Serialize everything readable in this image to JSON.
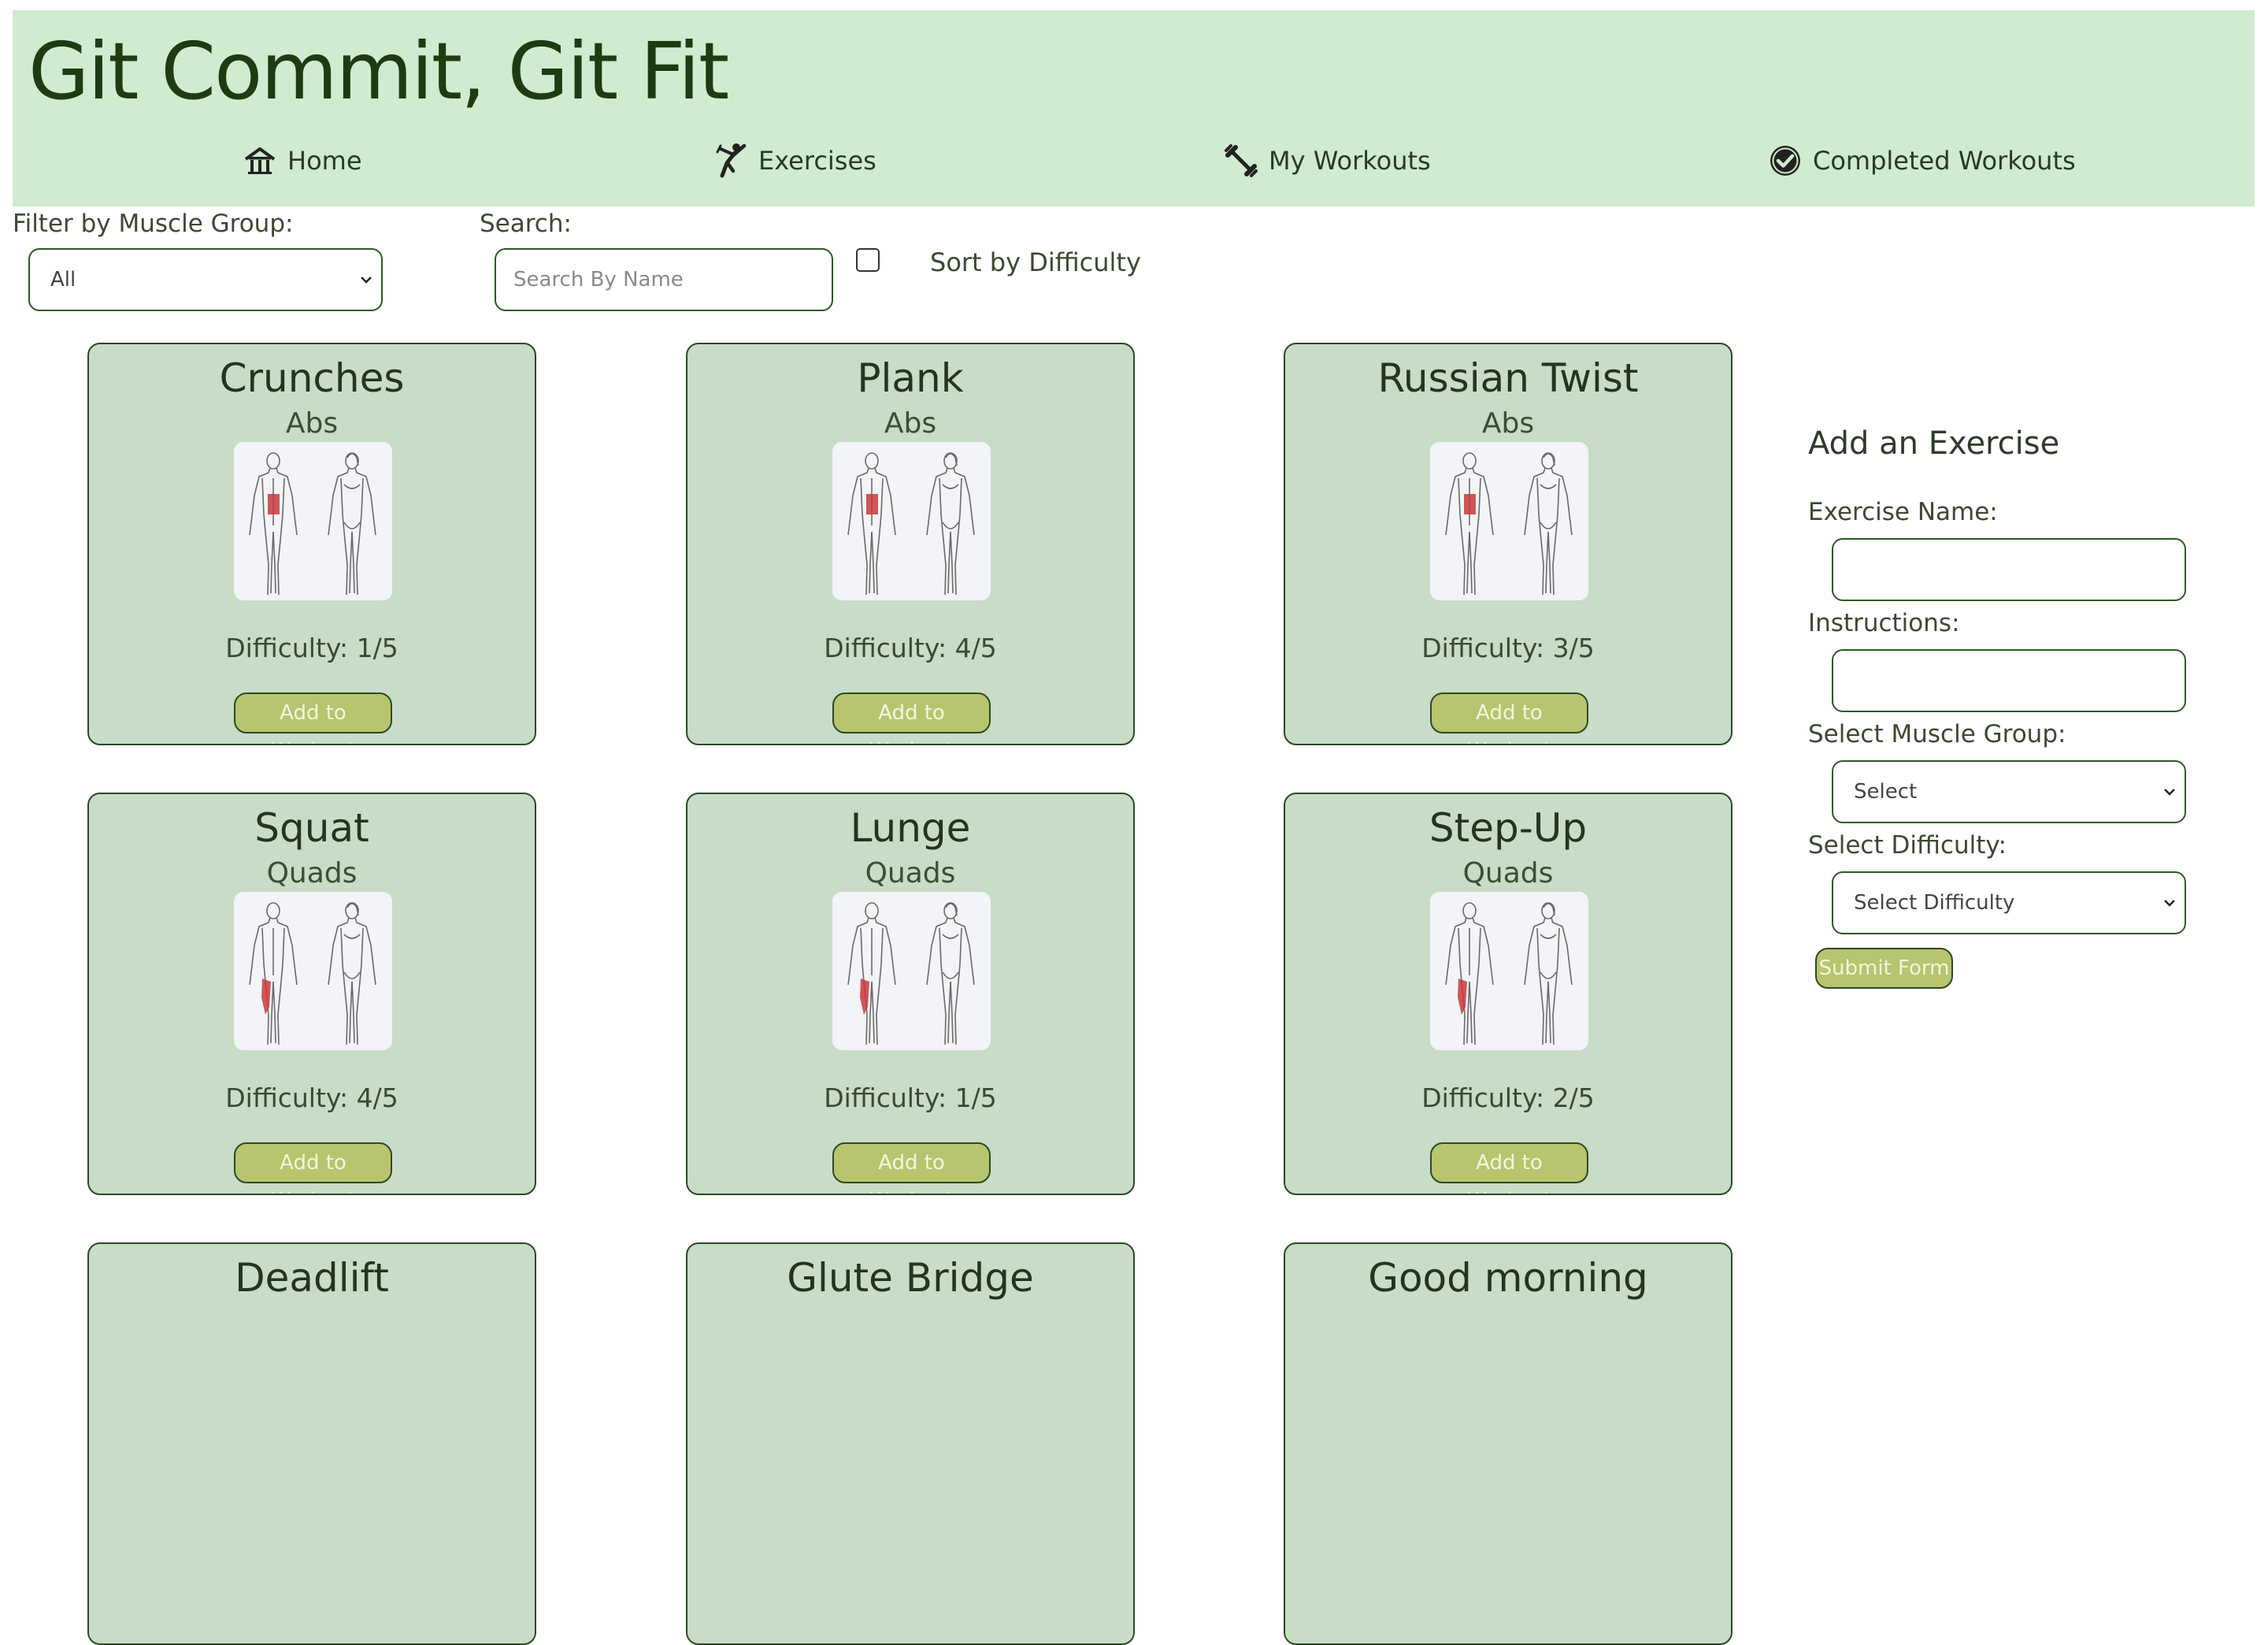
{
  "header": {
    "title": "Git Commit, Git Fit",
    "nav": [
      {
        "label": "Home",
        "icon": "house-icon"
      },
      {
        "label": "Exercises",
        "icon": "martial-arts-icon"
      },
      {
        "label": "My Workouts",
        "icon": "dumbbell-icon"
      },
      {
        "label": "Completed Workouts",
        "icon": "check-circle-icon"
      }
    ]
  },
  "filters": {
    "muscle_label": "Filter by Muscle Group:",
    "muscle_value": "All",
    "search_label": "Search:",
    "search_placeholder": "Search By Name",
    "sort_label": "Sort by Difficulty",
    "sort_checked": false
  },
  "exercises": [
    {
      "name": "Crunches",
      "muscle": "Abs",
      "difficulty": "Difficulty: 1/5",
      "button": "Add to Workout",
      "highlight": "abs"
    },
    {
      "name": "Plank",
      "muscle": "Abs",
      "difficulty": "Difficulty: 4/5",
      "button": "Add to Workout",
      "highlight": "abs"
    },
    {
      "name": "Russian Twist",
      "muscle": "Abs",
      "difficulty": "Difficulty: 3/5",
      "button": "Add to Workout",
      "highlight": "abs"
    },
    {
      "name": "Squat",
      "muscle": "Quads",
      "difficulty": "Difficulty: 4/5",
      "button": "Add to Workout",
      "highlight": "quads"
    },
    {
      "name": "Lunge",
      "muscle": "Quads",
      "difficulty": "Difficulty: 1/5",
      "button": "Add to Workout",
      "highlight": "quads"
    },
    {
      "name": "Step-Up",
      "muscle": "Quads",
      "difficulty": "Difficulty: 2/5",
      "button": "Add to Workout",
      "highlight": "quads"
    },
    {
      "name": "Deadlift",
      "muscle": "",
      "difficulty": "",
      "button": "",
      "highlight": ""
    },
    {
      "name": "Glute Bridge",
      "muscle": "",
      "difficulty": "",
      "button": "",
      "highlight": ""
    },
    {
      "name": "Good morning",
      "muscle": "",
      "difficulty": "",
      "button": "",
      "highlight": ""
    }
  ],
  "form": {
    "title": "Add an Exercise",
    "name_label": "Exercise Name:",
    "name_value": "",
    "instructions_label": "Instructions:",
    "instructions_value": "",
    "muscle_label": "Select Muscle Group:",
    "muscle_value": "Select",
    "difficulty_label": "Select Difficulty:",
    "difficulty_value": "Select Difficulty",
    "submit_label": "Submit Form"
  },
  "colors": {
    "header_bg": "#d0ebd0",
    "card_bg": "#c8dcc8",
    "button_bg": "#b9c46e",
    "muscle_highlight": "#c93a3a"
  }
}
